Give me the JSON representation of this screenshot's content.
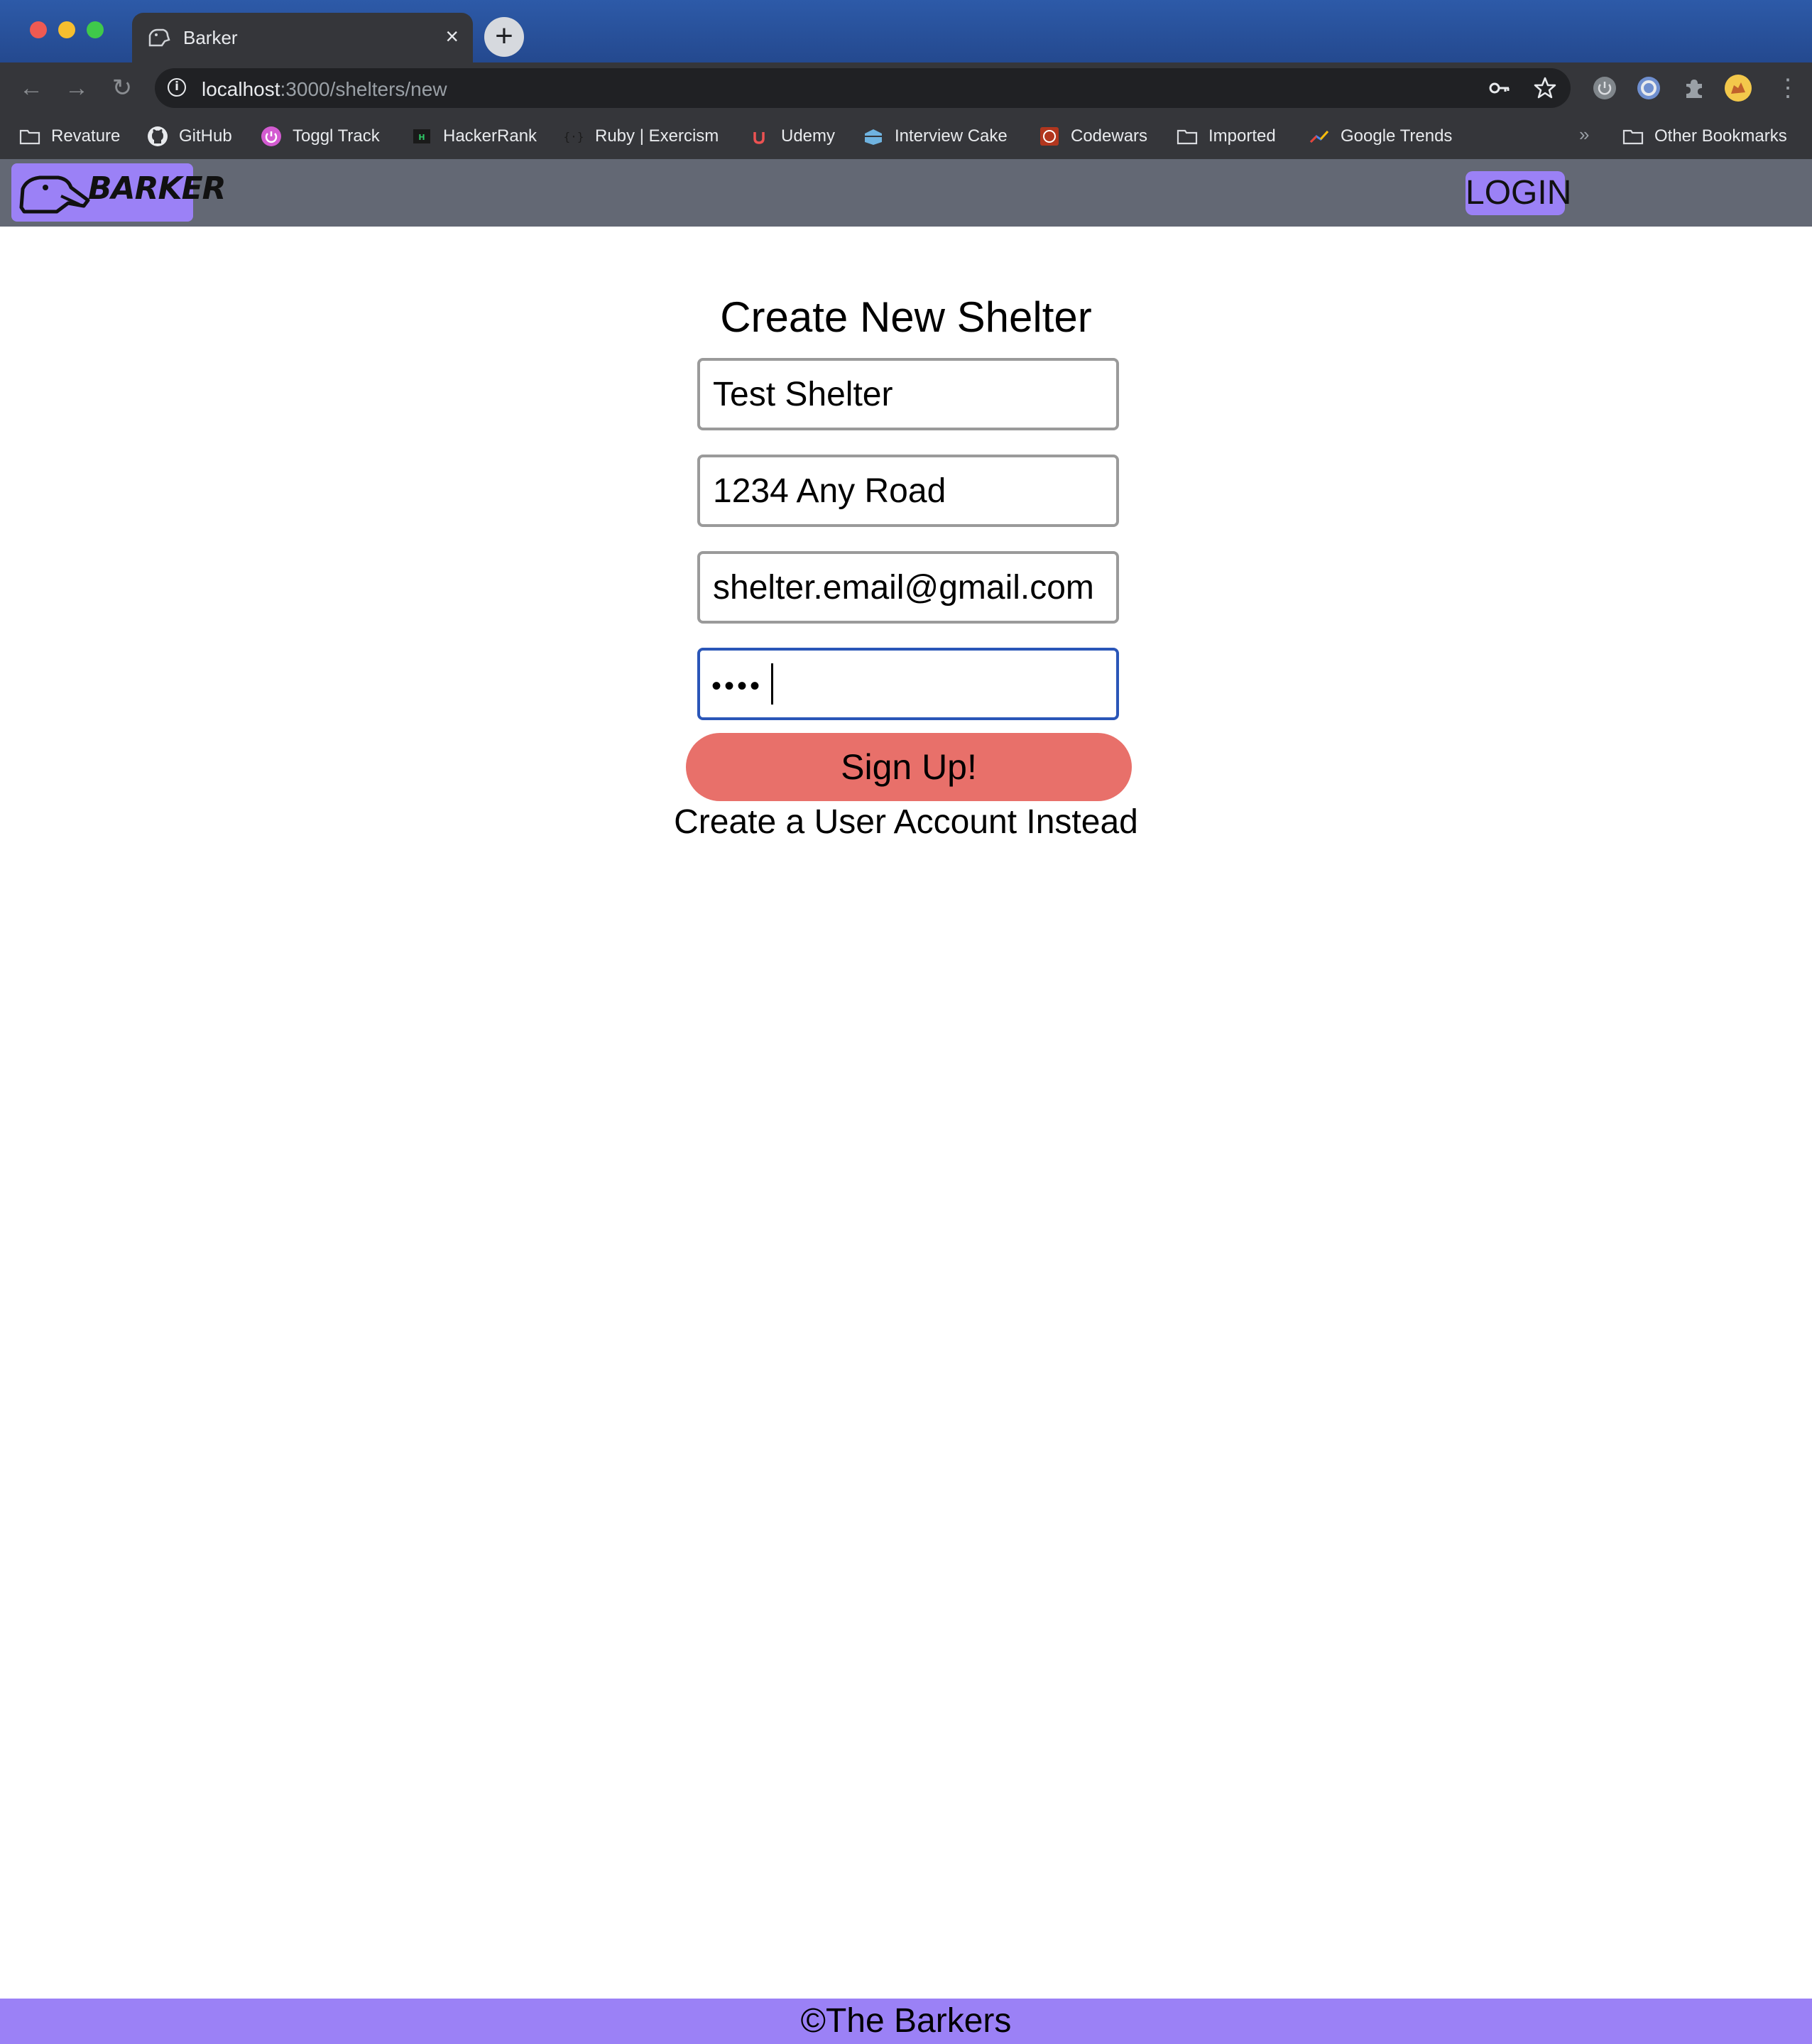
{
  "browser": {
    "tab": {
      "title": "Barker",
      "close_glyph": "×",
      "favicon": "dog-favicon"
    },
    "new_tab_glyph": "+",
    "nav": {
      "back_glyph": "←",
      "forward_glyph": "→",
      "reload_glyph": "↻"
    },
    "url": {
      "host": "localhost",
      "path": ":3000/shelters/new"
    },
    "omnibox_icons": [
      "key-icon",
      "star-icon"
    ],
    "extensions": [
      "power-extension-icon",
      "circle-extension-icon",
      "puzzle-icon",
      "profile-avatar"
    ],
    "menu_glyph": "⋮",
    "bookmarks": [
      {
        "label": "Revature",
        "icon": "folder-icon"
      },
      {
        "label": "GitHub",
        "icon": "github-icon"
      },
      {
        "label": "Toggl Track",
        "icon": "toggl-icon"
      },
      {
        "label": "HackerRank",
        "icon": "hackerrank-icon"
      },
      {
        "label": "Ruby | Exercism",
        "icon": "exercism-icon"
      },
      {
        "label": "Udemy",
        "icon": "udemy-icon"
      },
      {
        "label": "Interview Cake",
        "icon": "interview-cake-icon"
      },
      {
        "label": "Codewars",
        "icon": "codewars-icon"
      },
      {
        "label": "Imported",
        "icon": "folder-icon"
      },
      {
        "label": "Google Trends",
        "icon": "trends-icon"
      }
    ],
    "bookmarks_more_glyph": "»",
    "other_bookmarks": "Other Bookmarks"
  },
  "app": {
    "logo_text": "BARKER",
    "login_label": "LOGIN",
    "form": {
      "title": "Create New Shelter",
      "name_value": "Test Shelter",
      "address_value": "1234 Any Road",
      "email_value": "shelter.email@gmail.com",
      "password_masked": "••••",
      "submit_label": "Sign Up!",
      "alt_link": "Create a User Account Instead"
    },
    "footer": "©The Barkers"
  },
  "colors": {
    "header_bg": "#636874",
    "accent_purple": "#9b81f6",
    "signup_red": "#e8706a",
    "focus_blue": "#2a56b8"
  }
}
